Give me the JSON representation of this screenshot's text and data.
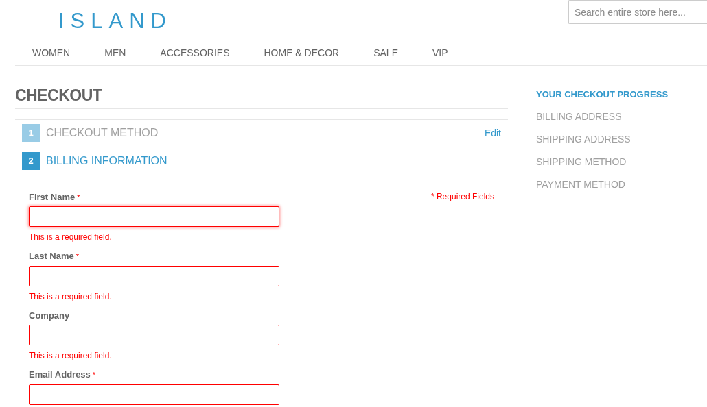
{
  "logo": "ISLAND",
  "search": {
    "placeholder": "Search entire store here..."
  },
  "nav": [
    "WOMEN",
    "MEN",
    "ACCESSORIES",
    "HOME & DECOR",
    "SALE",
    "VIP"
  ],
  "page_title": "CHECKOUT",
  "steps": [
    {
      "number": "1",
      "title": "CHECKOUT METHOD",
      "selected": false,
      "edit": "Edit"
    },
    {
      "number": "2",
      "title": "BILLING INFORMATION",
      "selected": true
    }
  ],
  "required_note": "* Required Fields",
  "fields": [
    {
      "label": "First Name",
      "required_mark": "*",
      "focused": true,
      "error": "This is a required field."
    },
    {
      "label": "Last Name",
      "required_mark": "*",
      "focused": false,
      "error": "This is a required field."
    },
    {
      "label": "Company",
      "focused": false,
      "error": "This is a required field."
    },
    {
      "label": "Email Address",
      "required_mark": "*",
      "focused": false
    }
  ],
  "progress": {
    "title": "YOUR CHECKOUT PROGRESS",
    "items": [
      "BILLING ADDRESS",
      "SHIPPING ADDRESS",
      "SHIPPING METHOD",
      "PAYMENT METHOD"
    ]
  }
}
